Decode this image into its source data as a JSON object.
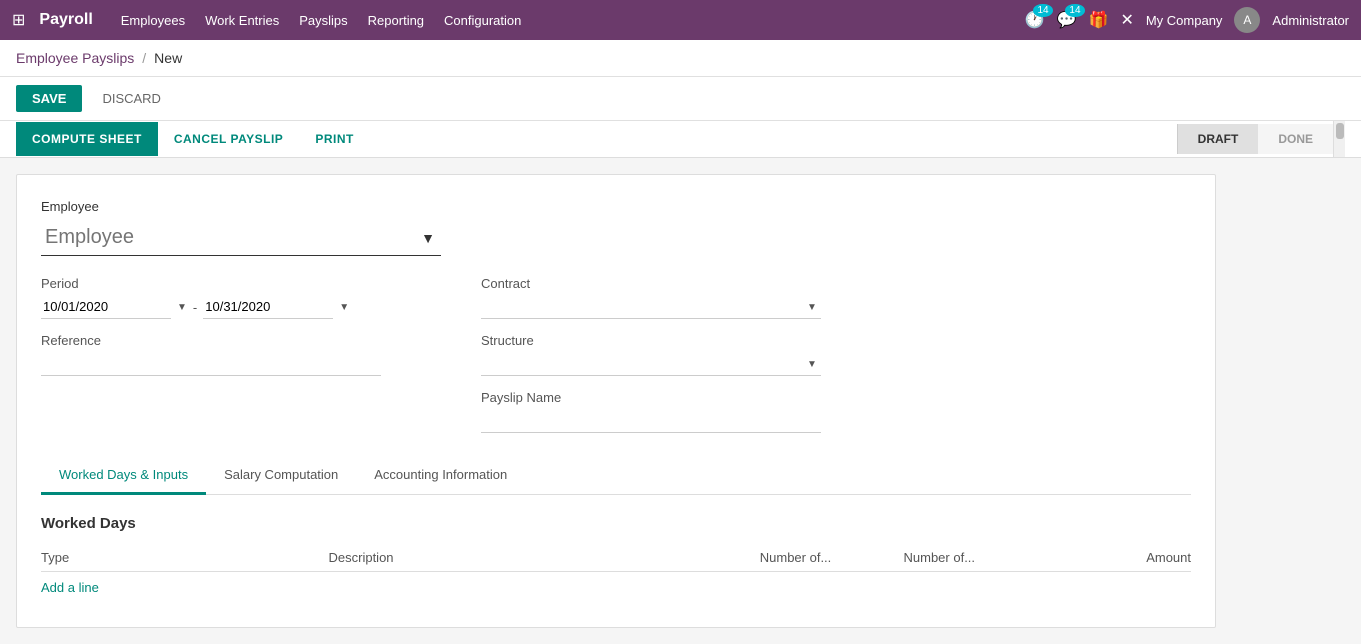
{
  "app": {
    "name": "Payroll",
    "grid_icon": "⊞"
  },
  "nav": {
    "links": [
      "Employees",
      "Work Entries",
      "Payslips",
      "Reporting",
      "Configuration"
    ],
    "badge1": "14",
    "badge2": "14",
    "company": "My Company",
    "user": "Administrator"
  },
  "breadcrumb": {
    "parent": "Employee Payslips",
    "separator": "/",
    "current": "New"
  },
  "actions": {
    "save": "SAVE",
    "discard": "DISCARD"
  },
  "toolbar": {
    "compute_sheet": "COMPUTE SHEET",
    "cancel_payslip": "CANCEL PAYSLIP",
    "print": "PRINT",
    "status_draft": "DRAFT",
    "status_done": "DONE"
  },
  "form": {
    "employee_label": "Employee",
    "employee_placeholder": "Employee",
    "period_label": "Period",
    "period_from": "10/01/2020",
    "period_to": "10/31/2020",
    "reference_label": "Reference",
    "reference_value": "",
    "contract_label": "Contract",
    "structure_label": "Structure",
    "payslip_name_label": "Payslip Name"
  },
  "tabs": [
    {
      "id": "worked-days",
      "label": "Worked Days & Inputs",
      "active": true
    },
    {
      "id": "salary",
      "label": "Salary Computation",
      "active": false
    },
    {
      "id": "accounting",
      "label": "Accounting Information",
      "active": false
    }
  ],
  "worked_days": {
    "section_title": "Worked Days",
    "columns": [
      "Type",
      "Description",
      "Number of...",
      "Number of...",
      "Amount"
    ],
    "add_line": "Add a line"
  }
}
